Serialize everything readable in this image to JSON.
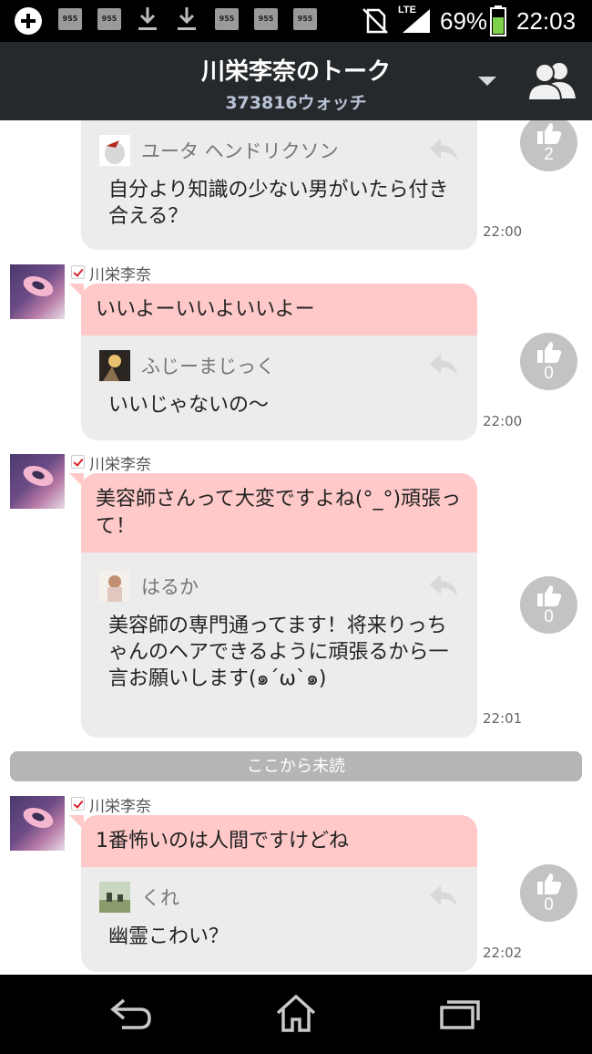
{
  "status_bar": {
    "battery": "69%",
    "time": "22:03",
    "network": "LTE",
    "notification_icons": [
      "955",
      "955",
      "download",
      "download",
      "955",
      "955",
      "955"
    ]
  },
  "header": {
    "title": "川栄李奈のトーク",
    "subtitle": "373816ウォッチ"
  },
  "unread_divider": "ここから未読",
  "messages": [
    {
      "sender": "",
      "answer": "",
      "reply": {
        "name": "ユータ ヘンドリクソン",
        "text": "自分より知識の少ない男がいたら付き合える？"
      },
      "time": "22:00",
      "likes": "2"
    },
    {
      "sender": "川栄李奈",
      "answer": "いいよーいいよいいよー",
      "reply": {
        "name": "ふじーまじっく",
        "text": "いいじゃないの～"
      },
      "time": "22:00",
      "likes": "0"
    },
    {
      "sender": "川栄李奈",
      "answer": "美容師さんって大変ですよね(°_°)頑張って！",
      "reply": {
        "name": "はるか",
        "text": "美容師の専門通ってます！将来りっちゃんのヘアできるように頑張るから一言お願いします(๑´ω`๑)"
      },
      "time": "22:01",
      "likes": "0"
    },
    {
      "sender": "川栄李奈",
      "answer": "1番怖いのは人間ですけどね",
      "reply": {
        "name": "くれ",
        "text": "幽霊こわい？"
      },
      "time": "22:02",
      "likes": "0"
    }
  ],
  "nav": {
    "icons": [
      "back-icon",
      "home-icon",
      "recents-icon"
    ]
  },
  "colors": {
    "header_bg": "#26292b",
    "answer_bubble": "#ffc9c9",
    "reply_bubble": "#ececec",
    "like_button": "#c3c3c3",
    "divider": "#b5b5b5"
  }
}
